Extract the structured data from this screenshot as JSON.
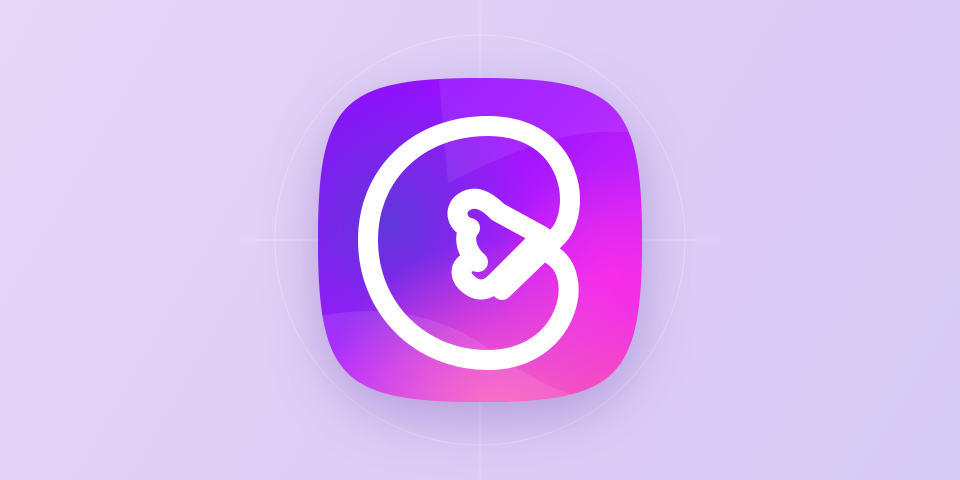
{
  "background": {
    "color_start": "#e6d6f7",
    "color_end": "#d6cbf5"
  },
  "app_icon": {
    "icon": "heart-loop-logo-icon",
    "gradient_colors": [
      "#8a10ff",
      "#b51cff",
      "#e22bf5",
      "#ff3fb0"
    ],
    "glyph_color": "#ffffff"
  }
}
